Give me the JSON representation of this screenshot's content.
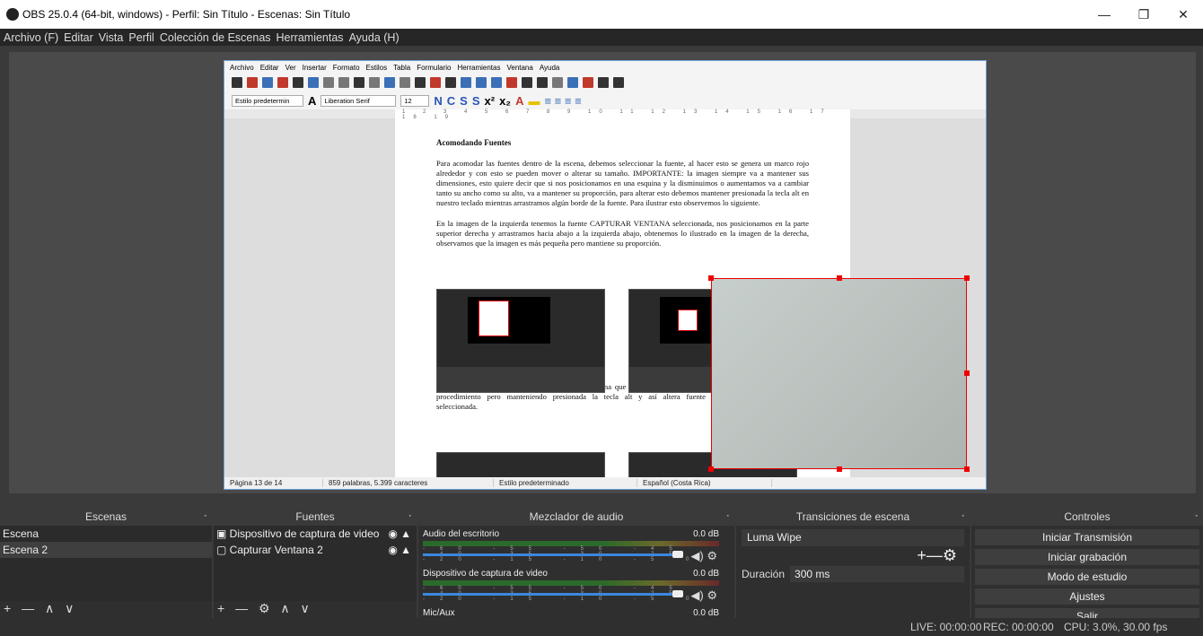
{
  "window": {
    "title": "OBS 25.0.4 (64-bit, windows) - Perfil: Sin Título - Escenas: Sin Título",
    "minimize": "—",
    "restore": "❐",
    "close": "✕"
  },
  "menu": [
    "Archivo (F)",
    "Editar",
    "Vista",
    "Perfil",
    "Colección de Escenas",
    "Herramientas",
    "Ayuda (H)"
  ],
  "writer": {
    "menu": [
      "Archivo",
      "Editar",
      "Ver",
      "Insertar",
      "Formato",
      "Estilos",
      "Tabla",
      "Formulario",
      "Herramientas",
      "Ventana",
      "Ayuda"
    ],
    "style_box": "Estilo predetermin",
    "font_box": "Liberation Serif",
    "size_box": "12",
    "ruler": "1 2 3 4 5 6 7 8 9 10 11 12 13 14 15 16 17 18 19",
    "heading": "Acomodando Fuentes",
    "p1": "Para acomodar las fuentes dentro de la escena, debemos seleccionar la fuente, al hacer esto se genera un marco rojo alrededor y con esto se pueden mover o alterar su tamaño. IMPORTANTE: la imagen siempre va a mantener sus dimensiones, esto quiere decir que si nos posicionamos en una esquina y la disminuimos o aumentamos va a cambiar tanto su ancho como su alto, va a mantener su proporción, para alterar esto debemos mantener presionada la tecla alt en nuestro teclado mientras arrastramos algún borde de la fuente. Para ilustrar esto observemos lo siguiente.",
    "p2": "En la imagen de la izquierda tenemos la fuente CAPTURAR VENTANA seleccionada, nos posicionamos en la parte superior derecha y arrastramos hacia abajo a la izquierda abajo, obtenemos lo ilustrado en la imagen de la derecha, observamos que la imagen es más pequeña pero mantiene su proporción.",
    "p3": "Por otro lado, la imaegn de la izquierda es la misma que la anterior, pero mismo procedimiento pero manteniendo presionada la tecla alt y así altera fuente seleccionada.",
    "status": [
      "Página 13 de 14",
      "859 palabras, 5.399 caracteres",
      "Estilo predeterminado",
      "Español (Costa Rica)"
    ]
  },
  "docks": {
    "scenes": {
      "title": "Escenas",
      "items": [
        "Escena",
        "Escena 2"
      ],
      "footer": "+ — ∧ ∨"
    },
    "sources": {
      "title": "Fuentes",
      "items": [
        "Dispositivo de captura de video",
        "Capturar Ventana 2"
      ],
      "footer": "+ — ⚙ ∧ ∨"
    },
    "mixer": {
      "title": "Mezclador de audio",
      "channels": [
        {
          "name": "Audio del escritorio",
          "db": "0.0 dB"
        },
        {
          "name": "Dispositivo de captura de video",
          "db": "0.0 dB"
        },
        {
          "name": "Mic/Aux",
          "db": "0.0 dB"
        }
      ],
      "ticks": "-60 -55 -50 -45 -40 -35 -30 -25 -20 -15 -10 -5 0"
    },
    "transitions": {
      "title": "Transiciones de escena",
      "selected": "Luma Wipe",
      "plusminus": "+—⚙",
      "duration_label": "Duración",
      "duration": "300 ms"
    },
    "controls": {
      "title": "Controles",
      "buttons": [
        "Iniciar Transmisión",
        "Iniciar grabación",
        "Modo de estudio",
        "Ajustes",
        "Salir"
      ]
    }
  },
  "statusbar": {
    "live": "LIVE: 00:00:00",
    "rec": "REC: 00:00:00",
    "cpu": "CPU: 3.0%, 30.00 fps"
  }
}
